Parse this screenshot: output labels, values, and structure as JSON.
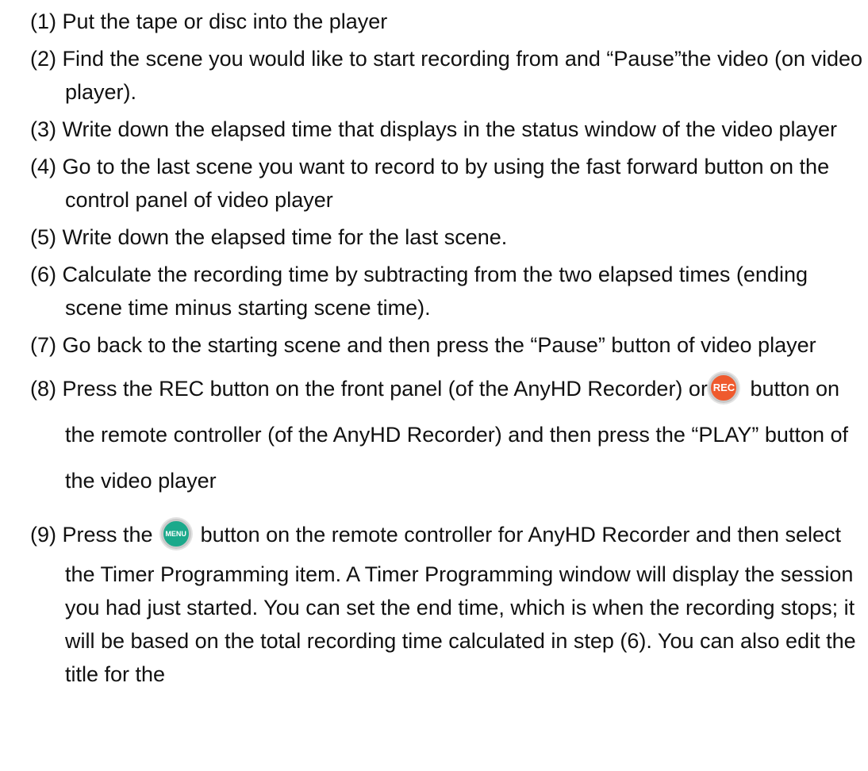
{
  "steps": [
    {
      "num": "(1)",
      "text": "Put the tape or disc into the player"
    },
    {
      "num": "(2)",
      "text": "Find the scene you would like to start recording from and “Pause”the video (on video player)."
    },
    {
      "num": "(3)",
      "text": "Write down the elapsed time that displays in the status window of the video player"
    },
    {
      "num": "(4)",
      "text": "Go to the last scene you want to record to by using the fast forward button on the control panel of video player"
    },
    {
      "num": "(5)",
      "text": "Write down the elapsed time for the last scene."
    },
    {
      "num": "(6)",
      "text": "Calculate the recording time by subtracting from the two elapsed times (ending scene time minus starting scene time)."
    },
    {
      "num": "(7)",
      "text": "Go back to the starting scene and then press the “Pause” button of video player"
    },
    {
      "num": "(8)",
      "text_before": "Press the REC button on the front panel (of the AnyHD Recorder) or",
      "icon_label": "REC",
      "icon_color": "#ef5a2e",
      "text_after": "button on the remote controller (of the AnyHD Recorder) and then press the “PLAY” button of the video player"
    },
    {
      "num": "(9)",
      "text_before": "Press the",
      "icon_label": "MENU",
      "icon_color": "#1ba98b",
      "text_after": "button on the remote controller for AnyHD Recorder and then select the Timer Programming item. A Timer Programming window will display the session you had just started. You can set the end time, which is when the recording stops; it will be based on the total recording time calculated in step (6). You can also edit the title for the"
    }
  ]
}
